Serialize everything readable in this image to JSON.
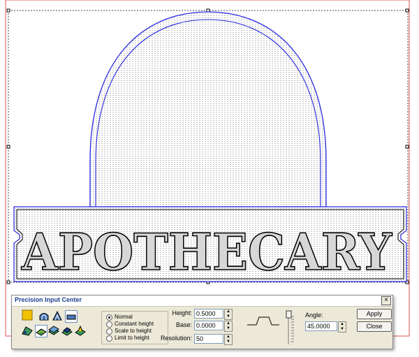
{
  "panel": {
    "title": "Precision Input Center",
    "close_label": "×"
  },
  "canvas": {
    "sign_text": "APOTHECARY"
  },
  "mode": {
    "options": [
      "Normal",
      "Constant height",
      "Scale to height",
      "Limit to height"
    ],
    "selected": "Normal"
  },
  "fields": {
    "height_label": "Height:",
    "height_value": "0.5000",
    "base_label": "Base:",
    "base_value": "0.0000",
    "resolution_label": "Resolution:",
    "resolution_value": "50",
    "angle_label": "Angle:",
    "angle_value": "45.0000"
  },
  "buttons": {
    "apply": "Apply",
    "close": "Close"
  },
  "colors": {
    "outline_blue": "#2a2ae0",
    "selection_border": "#e05050",
    "accent_yellow": "#f2c400"
  }
}
